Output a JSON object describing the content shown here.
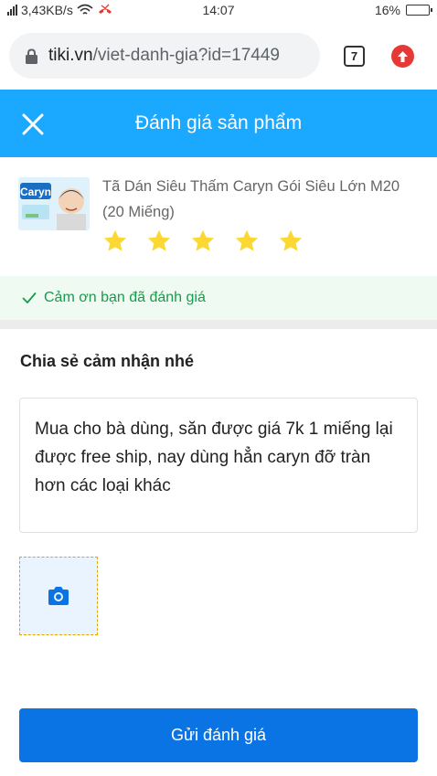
{
  "status_bar": {
    "network_speed": "3,43KB/s",
    "time": "14:07",
    "battery": "16%",
    "battery_level": 0.16
  },
  "browser": {
    "url_domain": "tiki.vn",
    "url_path": "/viet-danh-gia?id=17449",
    "tab_count": "7"
  },
  "header": {
    "title": "Đánh giá sản phẩm"
  },
  "product": {
    "name": "Tã Dán Siêu Thấm Caryn Gói Siêu Lớn M20 (20 Miếng)",
    "image_brand_text": "Caryn",
    "rating": 5,
    "rating_max": 5,
    "star_color": "#fdd835"
  },
  "thanks": {
    "message": "Cảm ơn bạn đã đánh giá"
  },
  "share": {
    "title": "Chia sẻ cảm nhận nhé",
    "review_text": "Mua cho bà dùng,  săn được giá 7k 1 miếng lại được free ship,  nay dùng hẳn caryn đỡ tràn hơn các loại khác"
  },
  "submit": {
    "label": "Gửi đánh giá"
  },
  "colors": {
    "header_bg": "#1ba8ff",
    "submit_bg": "#0b74e5",
    "success_text": "#1a9a4a",
    "success_bg": "#effaf3"
  }
}
